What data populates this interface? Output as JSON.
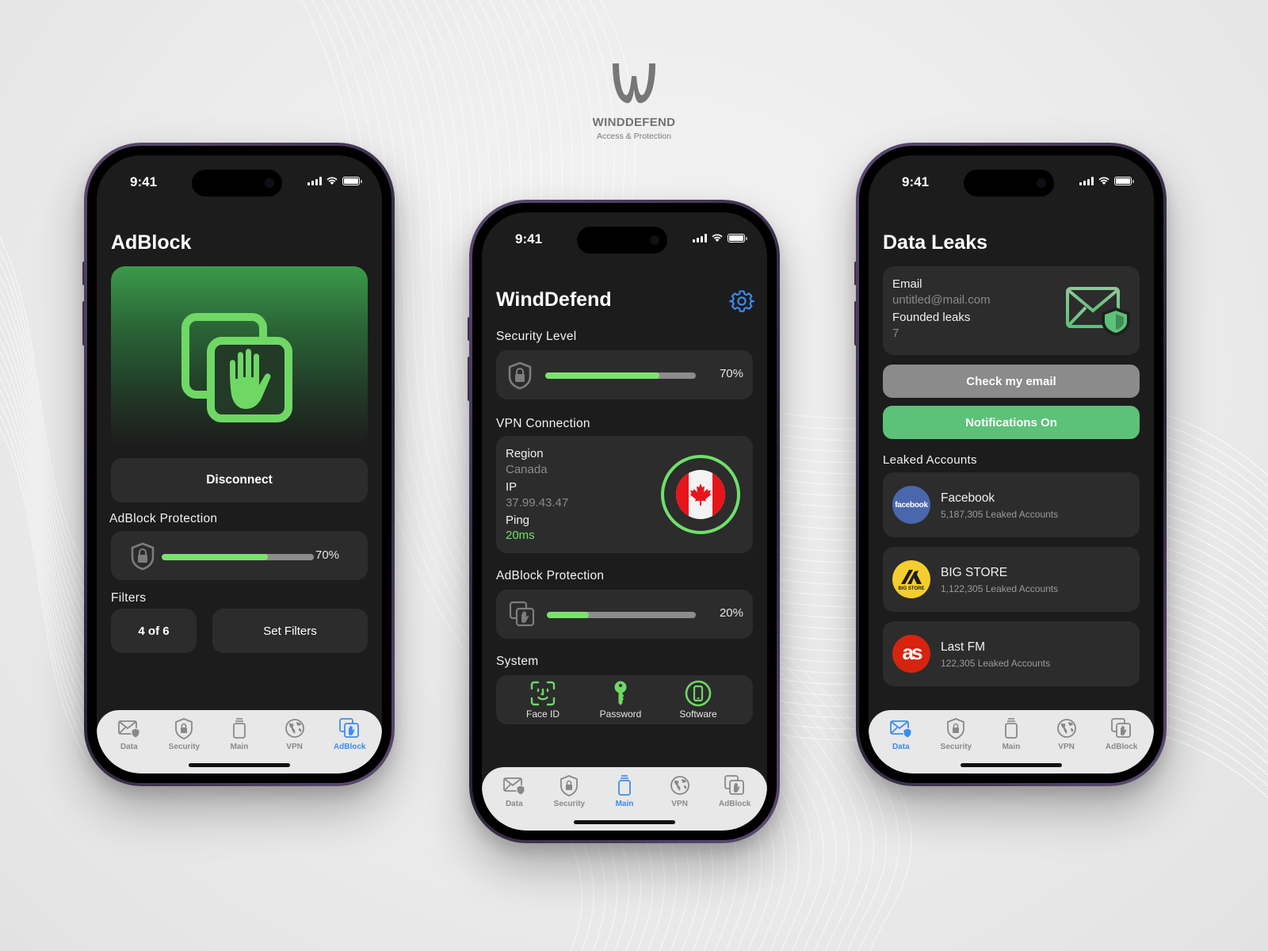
{
  "brand": {
    "name": "WINDDEFEND",
    "tagline": "Access & Protection"
  },
  "colors": {
    "accent_green": "#7be36d",
    "accent_blue": "#3b8cf0",
    "button_green": "#5cc179",
    "button_gray": "#8b8b8b",
    "screen_bg": "#1c1c1c",
    "card_bg": "#2c2c2c"
  },
  "status_bar": {
    "time": "9:41"
  },
  "tabs": [
    {
      "id": "data",
      "label": "Data",
      "icon": "mail-shield-icon"
    },
    {
      "id": "security",
      "label": "Security",
      "icon": "shield-lock-icon"
    },
    {
      "id": "main",
      "label": "Main",
      "icon": "stack-icon"
    },
    {
      "id": "vpn",
      "label": "VPN",
      "icon": "globe-icon"
    },
    {
      "id": "adblock",
      "label": "AdBlock",
      "icon": "hand-block-icon"
    }
  ],
  "adblock_screen": {
    "title": "AdBlock",
    "active_tab": "AdBlock",
    "disconnect_label": "Disconnect",
    "protection": {
      "label": "AdBlock Protection",
      "percent_text": "70%",
      "value": 0.7
    },
    "filters": {
      "label": "Filters",
      "count_text": "4 of 6",
      "set_label": "Set Filters"
    }
  },
  "main_screen": {
    "title": "WindDefend",
    "active_tab": "Main",
    "security_level": {
      "label": "Security Level",
      "percent_text": "70%",
      "value": 0.76
    },
    "vpn": {
      "label": "VPN Connection",
      "region_label": "Region",
      "region_value": "Canada",
      "ip_label": "IP",
      "ip_value": "37.99.43.47",
      "ping_label": "Ping",
      "ping_value": "20ms",
      "flag": "canada-flag"
    },
    "adblock": {
      "label": "AdBlock Protection",
      "percent_text": "20%",
      "value": 0.28
    },
    "system": {
      "label": "System",
      "items": [
        {
          "label": "Face ID",
          "icon": "face-id-icon"
        },
        {
          "label": "Password",
          "icon": "key-icon"
        },
        {
          "label": "Software",
          "icon": "phone-icon"
        }
      ]
    }
  },
  "data_screen": {
    "title": "Data Leaks",
    "active_tab": "Data",
    "email_label": "Email",
    "email_value": "untitled@mail.com",
    "leaks_label": "Founded leaks",
    "leaks_value": "7",
    "check_button": "Check my email",
    "notifications_button": "Notifications On",
    "leaked_accounts_label": "Leaked Accounts",
    "accounts": [
      {
        "name": "Facebook",
        "count": "5,187,305 Leaked Accounts",
        "logo_text": "facebook",
        "logo_color": "#4a67ad"
      },
      {
        "name": "BIG STORE",
        "count": "1,122,305 Leaked Accounts",
        "logo_text": "BIG STORE",
        "logo_color": "#f5cd2e"
      },
      {
        "name": "Last FM",
        "count": "122,305 Leaked Accounts",
        "logo_text": "as",
        "logo_color": "#d6240f"
      }
    ]
  }
}
